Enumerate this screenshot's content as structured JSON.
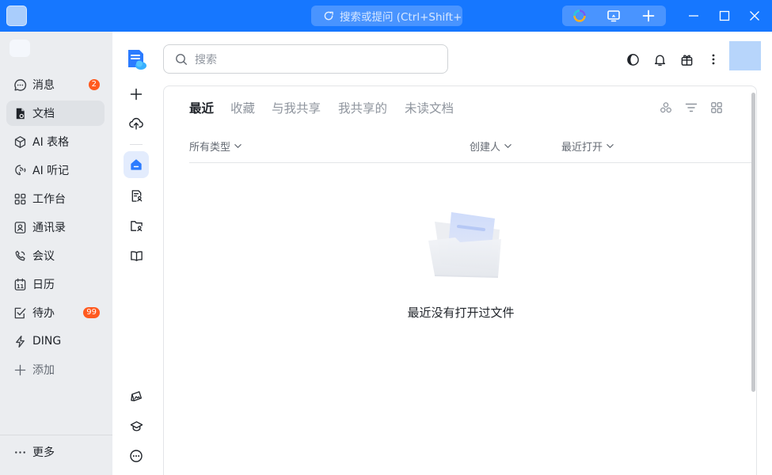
{
  "titlebar": {
    "search_placeholder": "搜索或提问 (Ctrl+Shift+",
    "colors": {
      "bar": "#1677ff"
    }
  },
  "sidebar": {
    "items": [
      {
        "label": "消息",
        "icon": "message-icon",
        "badge": "2"
      },
      {
        "label": "文档",
        "icon": "document-icon",
        "active": true
      },
      {
        "label": "AI 表格",
        "icon": "cube-icon"
      },
      {
        "label": "AI 听记",
        "icon": "audio-note-icon"
      },
      {
        "label": "工作台",
        "icon": "grid-icon"
      },
      {
        "label": "通讯录",
        "icon": "contacts-icon"
      },
      {
        "label": "会议",
        "icon": "phone-icon"
      },
      {
        "label": "日历",
        "icon": "calendar-icon"
      },
      {
        "label": "待办",
        "icon": "todo-icon",
        "badge": "99"
      },
      {
        "label": "DING",
        "icon": "lightning-icon"
      },
      {
        "label": "添加",
        "icon": "plus-icon"
      }
    ],
    "more_label": "更多",
    "calendar_day": "11"
  },
  "main": {
    "search_placeholder": "搜索",
    "tabs": [
      {
        "label": "最近",
        "active": true
      },
      {
        "label": "收藏"
      },
      {
        "label": "与我共享"
      },
      {
        "label": "我共享的"
      },
      {
        "label": "未读文档"
      }
    ],
    "filters": {
      "type": "所有类型",
      "creator": "创建人",
      "recent_open": "最近打开"
    },
    "empty_message": "最近没有打开过文件"
  }
}
